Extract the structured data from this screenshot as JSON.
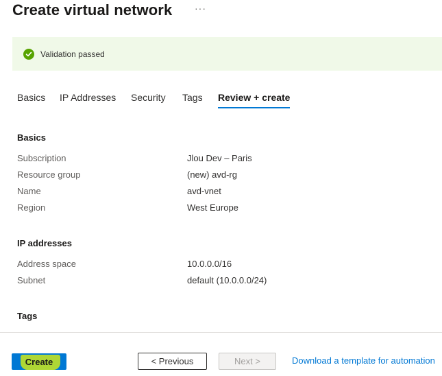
{
  "header": {
    "title": "Create virtual network",
    "more_label": "···"
  },
  "validation": {
    "text": "Validation passed",
    "status_color": "#57a300",
    "icon": "check-circle-icon"
  },
  "tabs": [
    {
      "label": "Basics",
      "active": false
    },
    {
      "label": "IP Addresses",
      "active": false
    },
    {
      "label": "Security",
      "active": false
    },
    {
      "label": "Tags",
      "active": false
    },
    {
      "label": "Review + create",
      "active": true
    }
  ],
  "sections": {
    "basics": {
      "title": "Basics",
      "rows": [
        {
          "label": "Subscription",
          "value": "Jlou Dev – Paris"
        },
        {
          "label": "Resource group",
          "value": "(new) avd-rg"
        },
        {
          "label": "Name",
          "value": "avd-vnet"
        },
        {
          "label": "Region",
          "value": "West Europe"
        }
      ]
    },
    "ip": {
      "title": "IP addresses",
      "rows": [
        {
          "label": "Address space",
          "value": "10.0.0.0/16"
        },
        {
          "label": "Subnet",
          "value": "default (10.0.0.0/24)"
        }
      ]
    },
    "tags": {
      "title": "Tags"
    }
  },
  "footer": {
    "create_label": "Create",
    "previous_label": "< Previous",
    "next_label": "Next >",
    "download_label": "Download a template for automation"
  },
  "colors": {
    "accent": "#0078d4",
    "highlight": "#e8f700"
  }
}
